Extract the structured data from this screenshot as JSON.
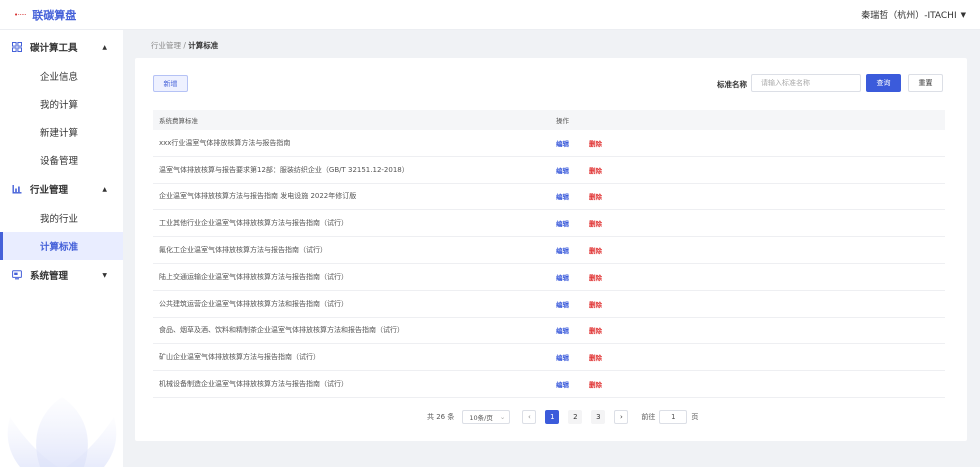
{
  "app": {
    "logo_text": "联碳算盘",
    "logo_mark": "•·····"
  },
  "header": {
    "user": "秦瑞哲（杭州）-ITACHI",
    "user_caret": "▼"
  },
  "sidebar": {
    "groups": [
      {
        "label": "碳计算工具",
        "icon": "grid-icon",
        "expanded": true,
        "items": [
          {
            "label": "企业信息"
          },
          {
            "label": "我的计算"
          },
          {
            "label": "新建计算"
          },
          {
            "label": "设备管理"
          }
        ]
      },
      {
        "label": "行业管理",
        "icon": "chart-icon",
        "expanded": true,
        "items": [
          {
            "label": "我的行业"
          },
          {
            "label": "计算标准",
            "active": true
          }
        ]
      },
      {
        "label": "系统管理",
        "icon": "monitor-icon",
        "expanded": false,
        "items": []
      }
    ],
    "arrow_up": "▲",
    "arrow_down": "▼"
  },
  "breadcrumb": {
    "parent": "行业管理",
    "separator": " / ",
    "current": "计算标准"
  },
  "toolbar": {
    "add_label": "新增",
    "filter_label": "标准名称",
    "filter_placeholder": "请输入标准名称",
    "query_label": "查询",
    "reset_label": "重置"
  },
  "table": {
    "headers": {
      "name": "系统费算标准",
      "ops": "操作"
    },
    "edit_label": "编辑",
    "delete_label": "删除",
    "rows": [
      "xxx行业温室气体排放核算方法与报告指南",
      "温室气体排放核算与报告要求第12部：服装纺织企业（GB/T 32151.12-2018）",
      "企业温室气体排放核算方法与报告指南 发电设施 2022年修订版",
      "工业其他行业企业温室气体排放核算方法与报告指南（试行）",
      "氟化工企业温室气体排放核算方法与报告指南（试行）",
      "陆上交通运输企业温室气体排放核算方法与报告指南（试行）",
      "公共建筑运营企业温室气体排放核算方法和报告指南（试行）",
      "食品、烟草及酒、饮料和精制茶企业温室气体排放核算方法和报告指南（试行）",
      "矿山企业温室气体排放核算方法与报告指南（试行）",
      "机械设备制造企业温室气体排放核算方法与报告指南（试行）"
    ]
  },
  "pagination": {
    "total": "共 26 条",
    "page_size": "10条/页",
    "size_caret": "⌄",
    "prev": "‹",
    "next": "›",
    "pages": [
      "1",
      "2",
      "3"
    ],
    "current_page": "1",
    "goto_label": "前往",
    "goto_value": "1",
    "goto_suffix": "页"
  },
  "colors": {
    "accent": "#3b5bdb",
    "danger": "#e03131",
    "active_bg": "#e9edff"
  }
}
